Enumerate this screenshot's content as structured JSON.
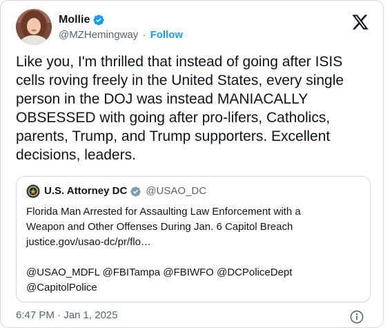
{
  "author": {
    "name": "Mollie",
    "handle": "@MZHemingway",
    "separator": "·",
    "follow_label": "Follow"
  },
  "tweet": {
    "text": "Like you, I'm thrilled that instead of going after ISIS cells roving freely in the United States, every single person in the DOJ was instead MANIACALLY OBSESSED with going after pro-lifers, Catholics, parents, Trump, and Trump supporters. Excellent decisions, leaders."
  },
  "quoted": {
    "name": "U.S. Attorney DC",
    "handle": "@USAO_DC",
    "lines": [
      "Florida Man Arrested for Assaulting Law Enforcement with a",
      "Weapon and Other Offenses During Jan. 6 Capitol Breach",
      "justice.gov/usao-dc/pr/flo…"
    ],
    "mention_lines": [
      "@USAO_MDFL @FBITampa @FBIWFO @DCPoliceDept",
      "@CapitolPolice"
    ]
  },
  "footer": {
    "timestamp": "6:47 PM · Jan 1, 2025"
  },
  "colors": {
    "accent": "#1d9bf0",
    "secondary_text": "#536471",
    "primary_text": "#0f1419",
    "border": "#cfd9de"
  },
  "icons": {
    "verified": "verified-badge-icon",
    "gov_badge": "government-badge-icon",
    "logo": "x-logo-icon",
    "info": "info-icon",
    "seal": "doj-seal-icon"
  }
}
